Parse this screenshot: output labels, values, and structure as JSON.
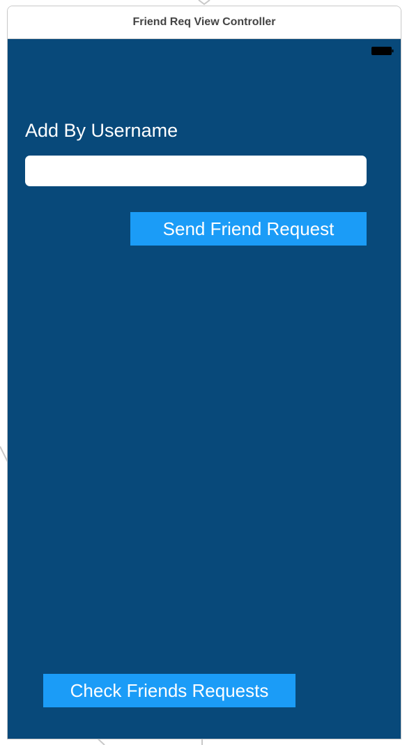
{
  "scene": {
    "title": "Friend Req View Controller"
  },
  "view": {
    "background_color": "#08497a",
    "add_label": "Add By Username",
    "username_field": {
      "value": "",
      "placeholder": ""
    },
    "send_button_label": "Send Friend Request",
    "check_button_label": "Check Friends Requests",
    "button_color": "#1b9cf7",
    "status_icons": [
      "battery-icon"
    ]
  }
}
